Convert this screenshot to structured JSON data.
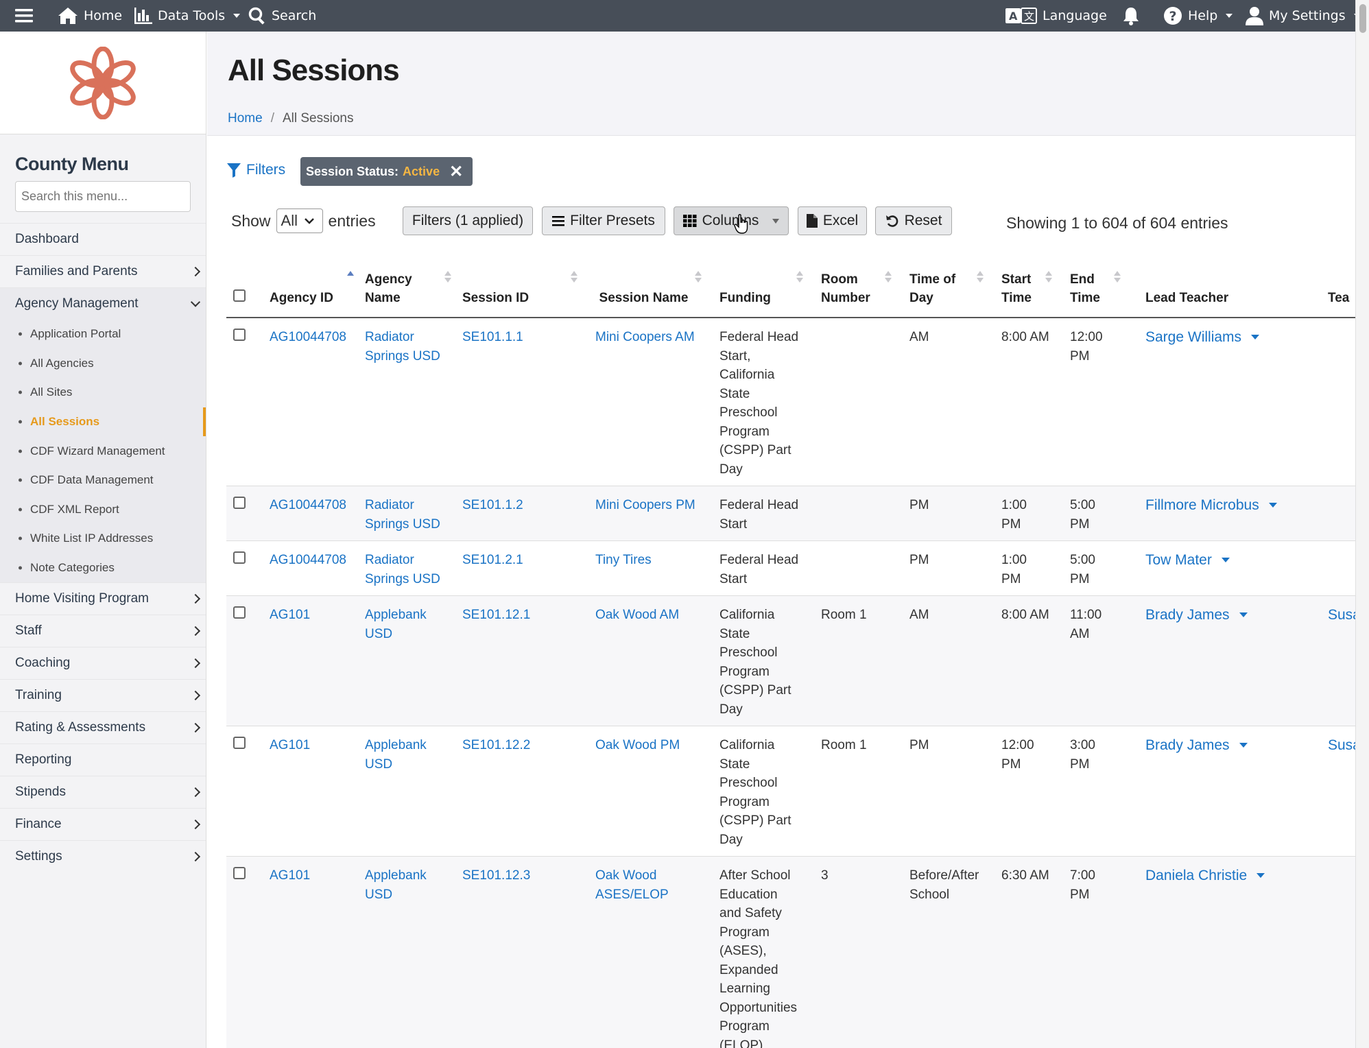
{
  "topbar": {
    "home": "Home",
    "data_tools": "Data Tools",
    "search": "Search",
    "language": "Language",
    "help": "Help",
    "my_settings": "My Settings"
  },
  "sidebar": {
    "title": "County Menu",
    "search_placeholder": "Search this menu...",
    "dashboard": "Dashboard",
    "families": "Families and Parents",
    "agency_mgmt": "Agency Management",
    "agency_sub": [
      "Application Portal",
      "All Agencies",
      "All Sites",
      "All Sessions",
      "CDF Wizard Management",
      "CDF Data Management",
      "CDF XML Report",
      "White List IP Addresses",
      "Note Categories"
    ],
    "home_visiting": "Home Visiting Program",
    "staff": "Staff",
    "coaching": "Coaching",
    "training": "Training",
    "rating": "Rating & Assessments",
    "reporting": "Reporting",
    "stipends": "Stipends",
    "finance": "Finance",
    "settings": "Settings"
  },
  "page": {
    "title": "All Sessions",
    "breadcrumb_home": "Home",
    "breadcrumb_sep": "/",
    "breadcrumb_current": "All Sessions"
  },
  "filters": {
    "link": "Filters",
    "chip_label": "Session Status:",
    "chip_value": "Active"
  },
  "toolbar": {
    "show": "Show",
    "show_value": "All",
    "entries": "entries",
    "filters_applied": "Filters (1 applied)",
    "filter_presets": "Filter Presets",
    "columns": "Columns",
    "excel": "Excel",
    "reset": "Reset",
    "showing": "Showing 1 to 604 of 604 entries"
  },
  "table": {
    "headers": {
      "agency_id": "Agency ID",
      "agency_name": "Agency Name",
      "session_id": "Session ID",
      "session_name": "Session Name",
      "funding": "Funding",
      "room": "Room Number",
      "time_of_day": "Time of Day",
      "start": "Start Time",
      "end": "End Time",
      "lead_teacher": "Lead Teacher",
      "teacher": "Tea"
    },
    "rows": [
      {
        "agency_id": "AG10044708",
        "agency_name": "Radiator Springs USD",
        "session_id": "SE101.1.1",
        "session_name": "Mini Coopers AM",
        "funding": "Federal Head Start, California State Preschool Program (CSPP) Part Day",
        "room": "",
        "tod": "AM",
        "start": "8:00 AM",
        "end": "12:00 PM",
        "lead": "Sarge Williams",
        "teacher": ""
      },
      {
        "agency_id": "AG10044708",
        "agency_name": "Radiator Springs USD",
        "session_id": "SE101.1.2",
        "session_name": "Mini Coopers PM",
        "funding": "Federal Head Start",
        "room": "",
        "tod": "PM",
        "start": "1:00 PM",
        "end": "5:00 PM",
        "lead": "Fillmore Microbus",
        "teacher": ""
      },
      {
        "agency_id": "AG10044708",
        "agency_name": "Radiator Springs USD",
        "session_id": "SE101.2.1",
        "session_name": "Tiny Tires",
        "funding": "Federal Head Start",
        "room": "",
        "tod": "PM",
        "start": "1:00 PM",
        "end": "5:00 PM",
        "lead": "Tow Mater",
        "teacher": ""
      },
      {
        "agency_id": "AG101",
        "agency_name": "Applebank USD",
        "session_id": "SE101.12.1",
        "session_name": "Oak Wood AM",
        "funding": "California State Preschool Program (CSPP) Part Day",
        "room": "Room 1",
        "tod": "AM",
        "start": "8:00 AM",
        "end": "11:00 AM",
        "lead": "Brady James",
        "teacher": "Susa"
      },
      {
        "agency_id": "AG101",
        "agency_name": "Applebank USD",
        "session_id": "SE101.12.2",
        "session_name": "Oak Wood PM",
        "funding": "California State Preschool Program (CSPP) Part Day",
        "room": "Room 1",
        "tod": "PM",
        "start": "12:00 PM",
        "end": "3:00 PM",
        "lead": "Brady James",
        "teacher": "Susa"
      },
      {
        "agency_id": "AG101",
        "agency_name": "Applebank USD",
        "session_id": "SE101.12.3",
        "session_name": "Oak Wood ASES/ELOP",
        "funding": "After School Education and Safety Program (ASES), Expanded Learning Opportunities Program (ELOP)",
        "room": "3",
        "tod": "Before/After School",
        "start": "6:30 AM",
        "end": "7:00 PM",
        "lead": "Daniela Christie",
        "teacher": ""
      }
    ]
  },
  "colors": {
    "topbar": "#474e58",
    "link": "#1a73c5",
    "active": "#e69a1c",
    "logo": "#d9715a"
  }
}
